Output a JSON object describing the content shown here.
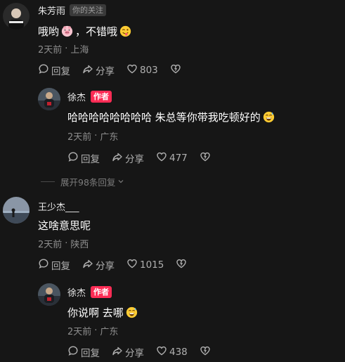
{
  "comments": [
    {
      "username": "朱芳雨",
      "badge": "你的关注",
      "text": "哦哟",
      "text_mid": "，不错哦",
      "date": "2天前",
      "location": "上海",
      "reply_label": "回复",
      "share_label": "分享",
      "likes": "803"
    },
    {
      "username": "徐杰",
      "badge": "作者",
      "text": "哈哈哈哈哈哈哈哈 朱总等你带我吃顿好的",
      "date": "2天前",
      "location": "广东",
      "reply_label": "回复",
      "share_label": "分享",
      "likes": "477"
    },
    {
      "username": "王少杰___",
      "text": "这啥意思呢",
      "date": "2天前",
      "location": "陕西",
      "reply_label": "回复",
      "share_label": "分享",
      "likes": "1015"
    },
    {
      "username": "徐杰",
      "badge": "作者",
      "text": "你说啊 去哪",
      "date": "2天前",
      "location": "广东",
      "reply_label": "回复",
      "share_label": "分享",
      "likes": "438"
    }
  ],
  "expand_replies": "展开98条回复",
  "separator": "·",
  "colors": {
    "background": "#161616",
    "author_badge": "#fe2c55",
    "muted": "#8d8d8d"
  },
  "icons": [
    "reply-icon",
    "share-icon",
    "heart-icon",
    "dislike-icon",
    "pig-emoji-icon",
    "tongue-emoji-icon",
    "sweat-emoji-icon",
    "chevron-down-icon"
  ]
}
